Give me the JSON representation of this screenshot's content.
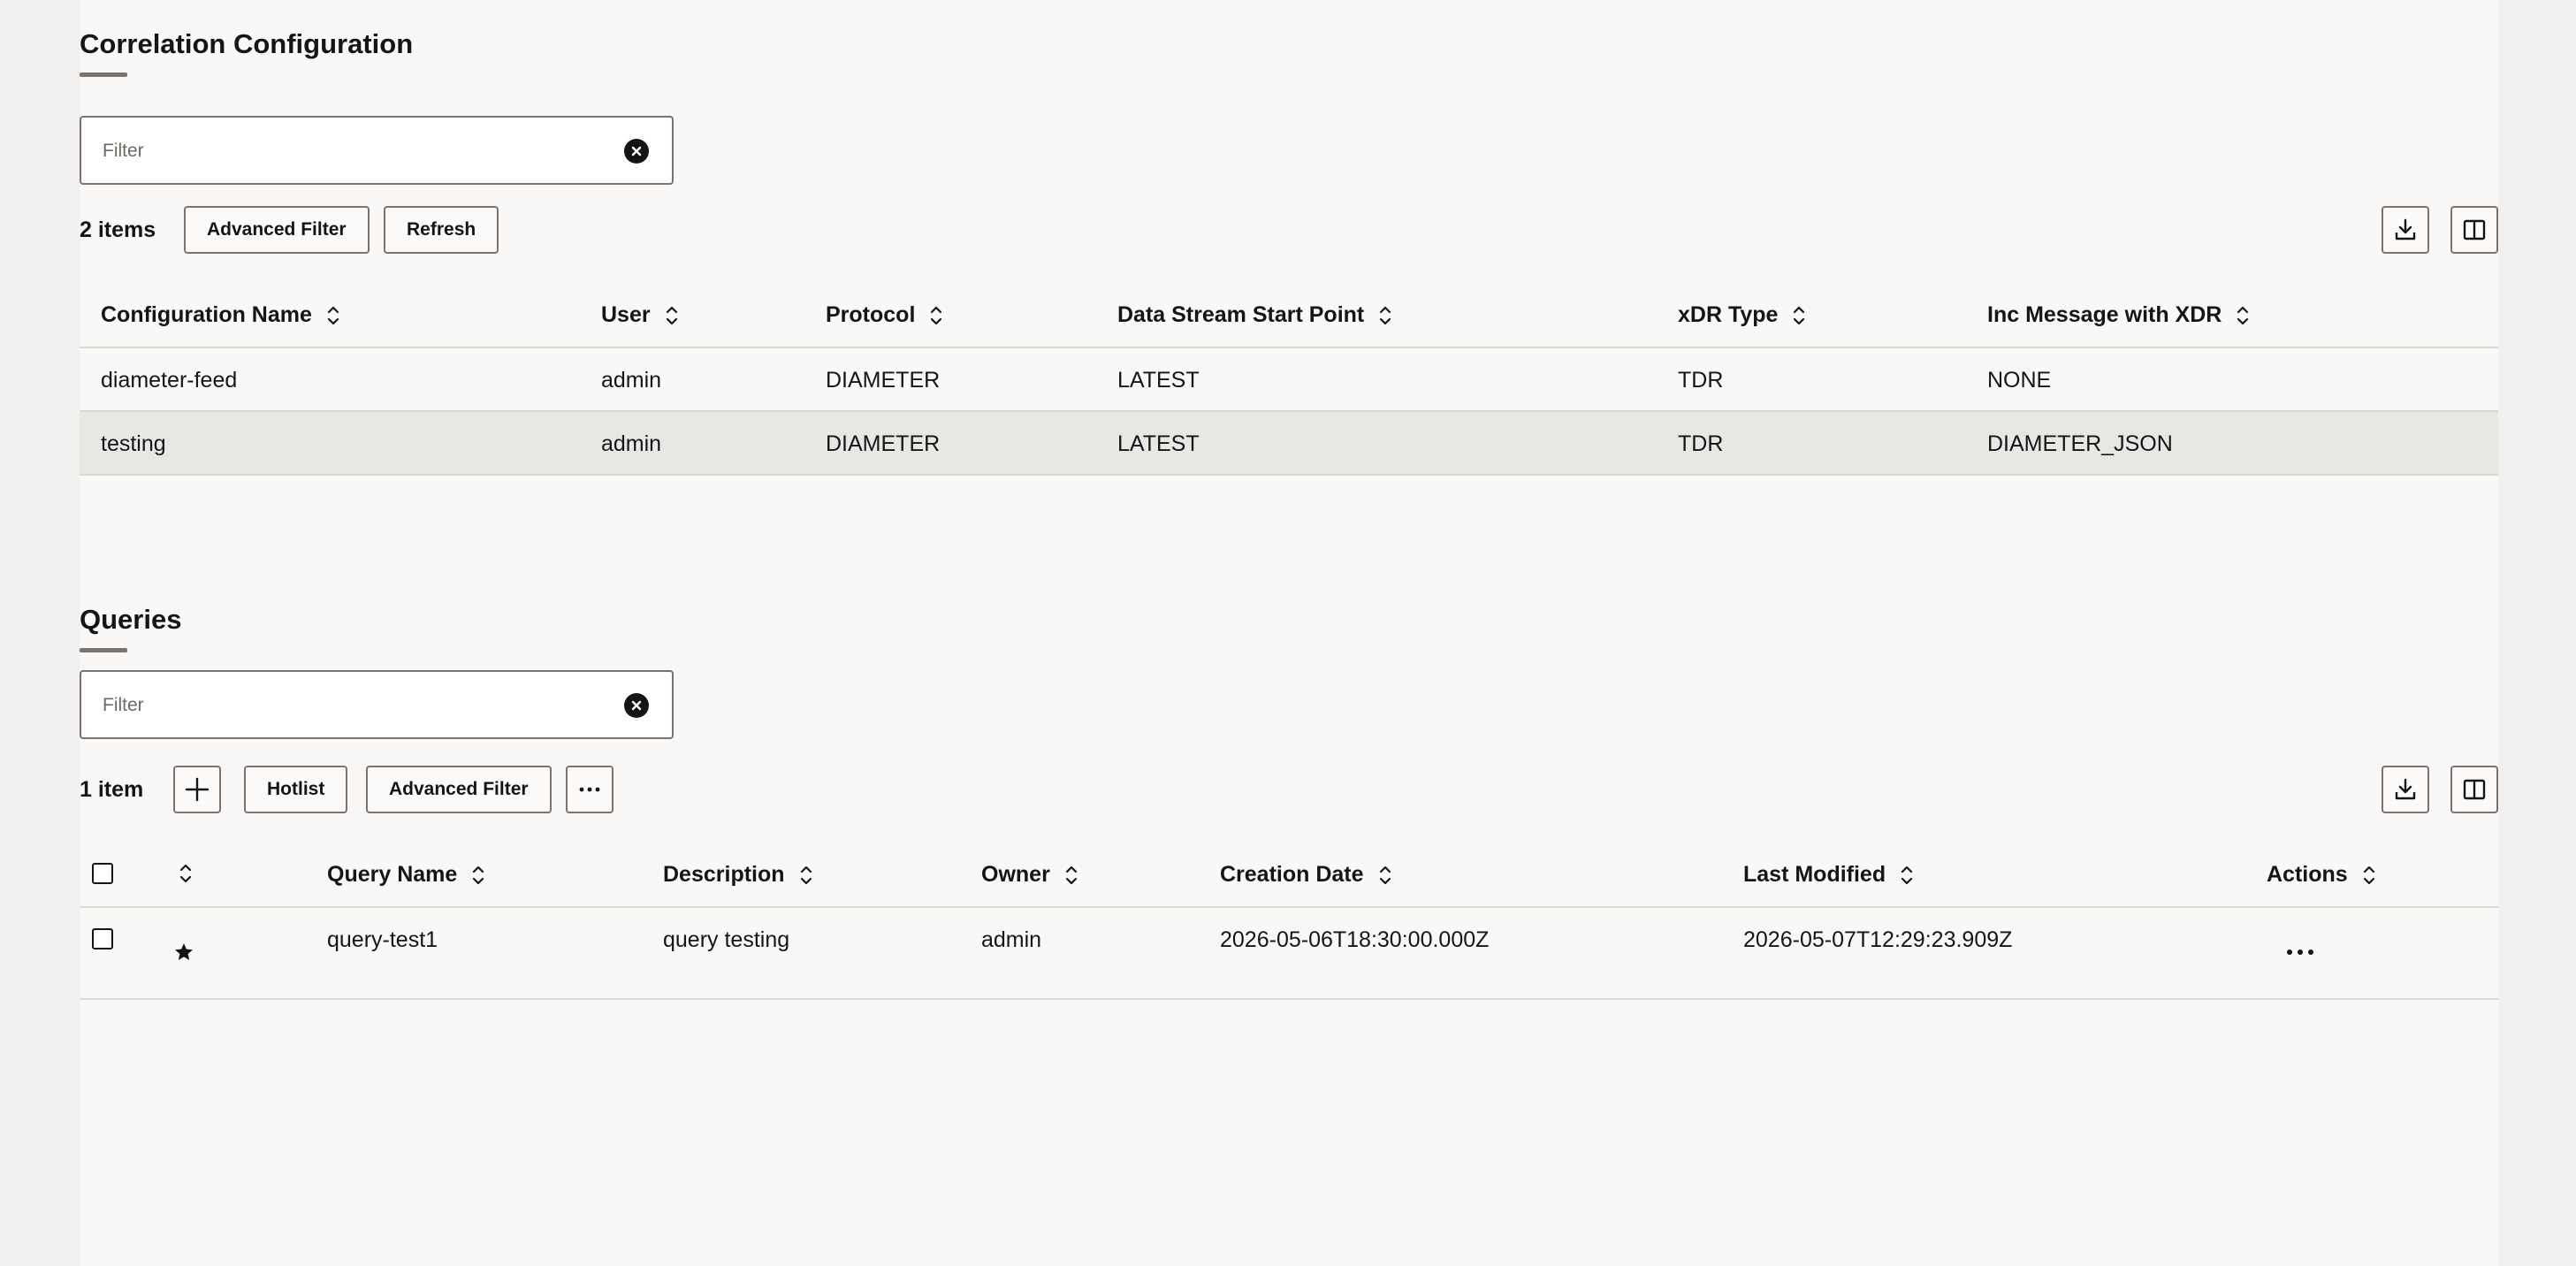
{
  "correlation": {
    "title": "Correlation Configuration",
    "filter_placeholder": "Filter",
    "count": "2 items",
    "buttons": {
      "advanced_filter": "Advanced Filter",
      "refresh": "Refresh"
    },
    "columns": [
      "Configuration Name",
      "User",
      "Protocol",
      "Data Stream Start Point",
      "xDR Type",
      "Inc Message with XDR"
    ],
    "rows": [
      [
        "diameter-feed",
        "admin",
        "DIAMETER",
        "LATEST",
        "TDR",
        "NONE"
      ],
      [
        "testing",
        "admin",
        "DIAMETER",
        "LATEST",
        "TDR",
        "DIAMETER_JSON"
      ]
    ]
  },
  "queries": {
    "title": "Queries",
    "filter_placeholder": "Filter",
    "count": "1 item",
    "buttons": {
      "hotlist": "Hotlist",
      "advanced_filter": "Advanced Filter"
    },
    "columns": [
      "Query Name",
      "Description",
      "Owner",
      "Creation Date",
      "Last Modified",
      "Actions"
    ],
    "rows": [
      [
        "query-test1",
        "query testing",
        "admin",
        "2026-05-06T18:30:00.000Z",
        "2026-05-07T12:29:23.909Z"
      ]
    ]
  },
  "icons": {
    "clear": "clear-icon",
    "sort": "sort-icon",
    "download": "download-icon",
    "columns": "columns-icon",
    "add": "plus-icon",
    "more": "more-icon",
    "favorite": "star-icon"
  },
  "colors": {
    "panel": "#f9f8f6",
    "background": "#f1f0ee",
    "selected_row": "#e9e7e4",
    "border": "#7a736e"
  }
}
